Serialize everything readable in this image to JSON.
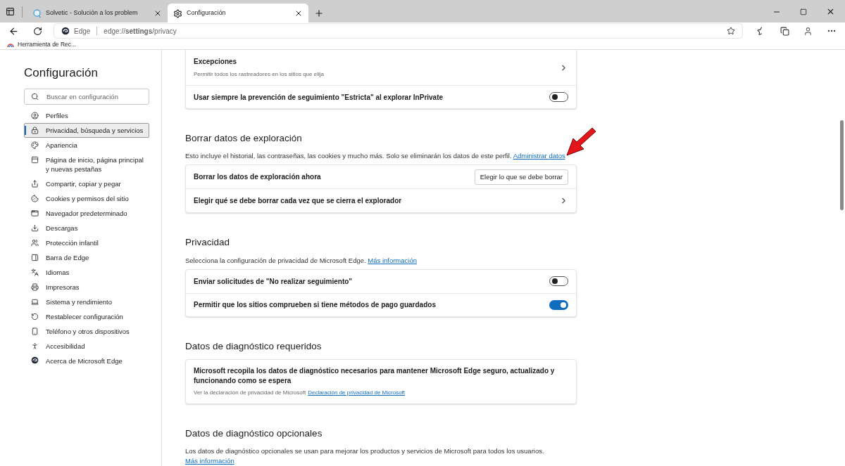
{
  "tabs": [
    {
      "title": "Solvetic - Solución a los problem",
      "selected": false
    },
    {
      "title": "Configuración",
      "selected": true
    }
  ],
  "address_bar": {
    "site_label": "Edge",
    "url": "edge://**settings**/privacy"
  },
  "bookmarks": [
    "Herramienta de Rec..."
  ],
  "sidebar": {
    "title": "Configuración",
    "search": {
      "placeholder": "Buscar en configuración"
    },
    "items": [
      {
        "label": "Perfiles",
        "selected": false
      },
      {
        "label": "Privacidad, búsqueda y servicios",
        "selected": true
      },
      {
        "label": "Apariencia",
        "selected": false
      },
      {
        "label": "Página de inicio, página principal y nuevas pestañas",
        "selected": false
      },
      {
        "label": "Compartir, copiar y pegar",
        "selected": false
      },
      {
        "label": "Cookies y permisos del sitio",
        "selected": false
      },
      {
        "label": "Navegador predeterminado",
        "selected": false
      },
      {
        "label": "Descargas",
        "selected": false
      },
      {
        "label": "Protección infantil",
        "selected": false
      },
      {
        "label": "Barra de Edge",
        "selected": false
      },
      {
        "label": "Idiomas",
        "selected": false
      },
      {
        "label": "Impresoras",
        "selected": false
      },
      {
        "label": "Sistema y rendimiento",
        "selected": false
      },
      {
        "label": "Restablecer configuración",
        "selected": false
      },
      {
        "label": "Teléfono y otros dispositivos",
        "selected": false
      },
      {
        "label": "Accesibilidad",
        "selected": false
      },
      {
        "label": "Acerca de Microsoft Edge",
        "selected": false
      }
    ]
  },
  "sections": [
    {
      "rows": [
        {
          "kind": "link",
          "label": "Excepciones",
          "sublabel": "Permitir todos los rastreadores en los sitios que elija"
        },
        {
          "kind": "toggle",
          "label": "Usar siempre la prevención de seguimiento \"Estricta\" al explorar InPrivate",
          "on": false
        }
      ]
    },
    {
      "heading": "Borrar datos de exploración",
      "description": "Esto incluye el historial, las contraseñas, las cookies y mucho más. Solo se eliminarán los datos de este perfil.",
      "link": "Administrar datos",
      "rows": [
        {
          "kind": "button",
          "label": "Borrar los datos de exploración ahora",
          "button": "Elegir lo que se debe borrar"
        },
        {
          "kind": "link",
          "label": "Elegir qué se debe borrar cada vez que se cierra el explorador"
        }
      ]
    },
    {
      "heading": "Privacidad",
      "description": "Selecciona la configuración de privacidad de Microsoft Edge.",
      "link": "Más información",
      "rows": [
        {
          "kind": "toggle",
          "label": "Enviar solicitudes de \"No realizar seguimiento\"",
          "on": false
        },
        {
          "kind": "toggle",
          "label": "Permitir que los sitios comprueben si tiene métodos de pago guardados",
          "on": true
        }
      ]
    },
    {
      "heading": "Datos de diagnóstico requeridos",
      "rows": [
        {
          "kind": "info",
          "label": "Microsoft recopila los datos de diagnóstico necesarios para mantener Microsoft Edge seguro, actualizado y funcionando como se espera",
          "note": "Ver la declaración de privacidad de Microsoft",
          "link": "Declaración de privacidad de Microsoft"
        }
      ]
    },
    {
      "heading": "Datos de diagnóstico opcionales",
      "description": "Los datos de diagnóstico opcionales se usan para mejorar los productos y servicios de Microsoft para todos los usuarios.",
      "link": "Más información"
    }
  ]
}
